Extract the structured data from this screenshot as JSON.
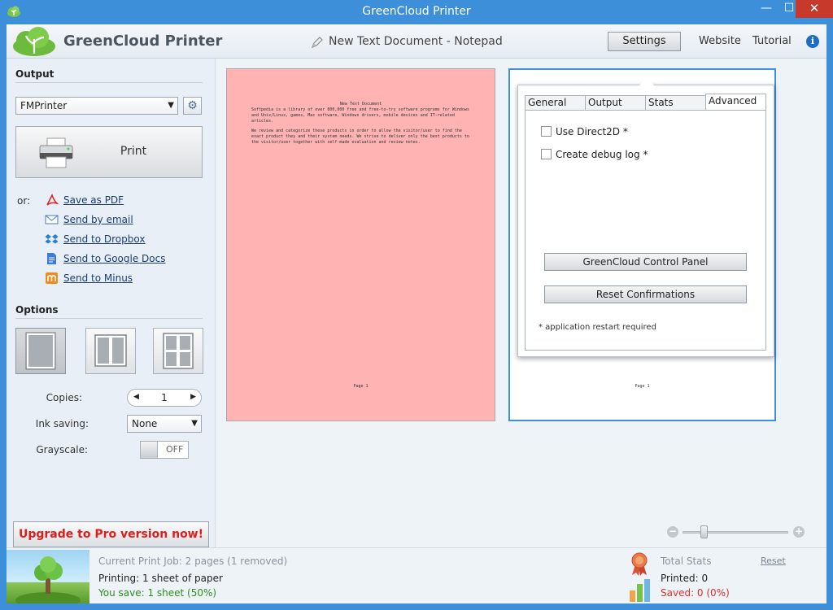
{
  "window": {
    "title": "GreenCloud Printer",
    "controls": {
      "minimize": "—",
      "maximize": "☐",
      "close": "✕"
    }
  },
  "header": {
    "brand": "GreenCloud Printer",
    "document_title": "New Text Document - Notepad",
    "settings_label": "Settings",
    "website_label": "Website",
    "tutorial_label": "Tutorial",
    "info_label": "i"
  },
  "output": {
    "title": "Output",
    "printer_selected": "FMPrinter",
    "print_label": "Print",
    "or_label": "or:",
    "share_items": [
      {
        "label": "Save as PDF",
        "icon": "pdf-icon"
      },
      {
        "label": "Send by email",
        "icon": "email-icon"
      },
      {
        "label": "Send to Dropbox",
        "icon": "dropbox-icon"
      },
      {
        "label": "Send to Google Docs",
        "icon": "google-docs-icon"
      },
      {
        "label": "Send to Minus",
        "icon": "minus-icon"
      }
    ]
  },
  "options": {
    "title": "Options",
    "copies_label": "Copies:",
    "copies_value": "1",
    "ink_saving_label": "Ink saving:",
    "ink_saving_value": "None",
    "grayscale_label": "Grayscale:",
    "grayscale_value": "OFF"
  },
  "upgrade_label": "Upgrade to Pro version now!",
  "preview": {
    "page1": {
      "title": "New Text Document",
      "para1": "Softpedia is a library of over 800,000 free and free-to-try software programs for Windows and Unix/Linux, games, Mac software, Windows drivers, mobile devices and IT-related articles.",
      "para2": "We review and categorize these products in order to allow the visitor/user to find the exact product they and their system needs. We strive to deliver only the best products to the visitor/user together with self-made evaluation and review notes.",
      "page_label": "Page 1"
    },
    "page2": {
      "page_label": "Page 1"
    }
  },
  "settings_popup": {
    "tabs": [
      "General",
      "Output",
      "Stats",
      "Advanced"
    ],
    "active_tab": "Advanced",
    "use_direct2d_label": "Use Direct2D *",
    "debug_log_label": "Create debug log *",
    "control_panel_label": "GreenCloud Control Panel",
    "reset_confirmations_label": "Reset Confirmations",
    "note": "* application restart required"
  },
  "footer": {
    "current_job": "Current Print Job: 2 pages (1 removed)",
    "printing": "Printing: 1 sheet of paper",
    "you_save": "You save: 1 sheet (50%)",
    "total_stats": "Total Stats",
    "reset_label": "Reset",
    "printed": "Printed: 0",
    "saved": "Saved: 0 (0%)"
  },
  "colors": {
    "accent_blue": "#3c8fd8",
    "upgrade_red": "#e21b1b",
    "save_green": "#2e8b1d",
    "saved_red": "#d9302a",
    "page_pink": "#ffb3b3"
  }
}
